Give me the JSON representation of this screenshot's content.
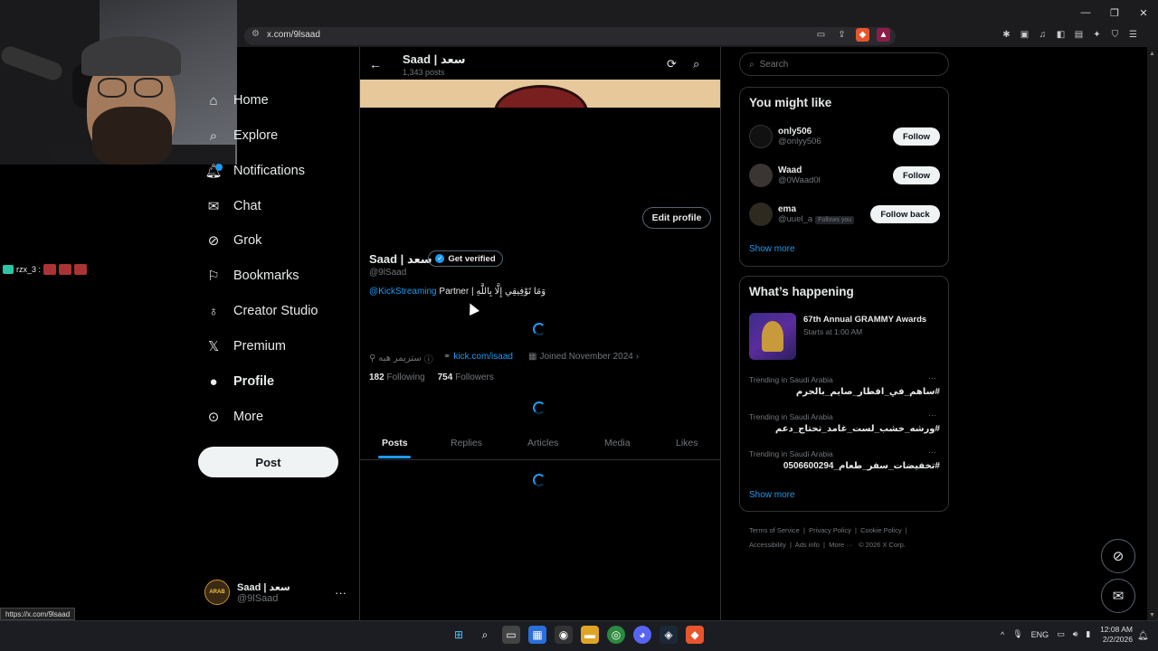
{
  "browser": {
    "url": "x.com/9lsaad",
    "status_url": "https://x.com/9lsaad"
  },
  "stream": {
    "chat_user": "rzx_3 :"
  },
  "nav": {
    "items": [
      {
        "label": "Home",
        "icon": "home-icon"
      },
      {
        "label": "Explore",
        "icon": "search-icon"
      },
      {
        "label": "Notifications",
        "icon": "bell-icon"
      },
      {
        "label": "Chat",
        "icon": "mail-icon"
      },
      {
        "label": "Grok",
        "icon": "grok-icon"
      },
      {
        "label": "Bookmarks",
        "icon": "bookmark-icon"
      },
      {
        "label": "Creator Studio",
        "icon": "creator-icon"
      },
      {
        "label": "Premium",
        "icon": "x-logo-icon"
      },
      {
        "label": "Profile",
        "icon": "person-icon"
      },
      {
        "label": "More",
        "icon": "more-circle-icon"
      }
    ],
    "post_label": "Post",
    "account": {
      "name": "Saad | سعد",
      "handle": "@9lSaad",
      "avatar_text": "ARAB"
    }
  },
  "profile": {
    "header_name": "Saad | سعد",
    "header_posts": "1,343 posts",
    "name": "Saad | سعد",
    "get_verified": "Get verified",
    "handle": "@9lSaad",
    "bio_link": "@KickStreaming",
    "bio_text": " Partner | وَمَا تَوْفِيقِي إِلَّا بِاللَّهِ",
    "edit_profile": "Edit profile",
    "location": "ستريمر هبه",
    "website": "kick.com/isaad",
    "joined": "Joined November 2024",
    "following_count": "182",
    "following_label": "Following",
    "followers_count": "754",
    "followers_label": "Followers",
    "tabs": [
      "Posts",
      "Replies",
      "Articles",
      "Media",
      "Likes"
    ]
  },
  "sidebar": {
    "search_placeholder": "Search",
    "might_like_title": "You might like",
    "suggestions": [
      {
        "name": "only506",
        "handle": "@onlyy506",
        "button": "Follow",
        "follows_you": ""
      },
      {
        "name": "Waad",
        "handle": "@0Waad0l",
        "button": "Follow",
        "follows_you": ""
      },
      {
        "name": "ema",
        "handle": "@uuel_a",
        "button": "Follow back",
        "follows_you": "Follows you"
      }
    ],
    "show_more": "Show more",
    "happening_title": "What’s happening",
    "event": {
      "title": "67th Annual GRAMMY Awards",
      "sub": "Starts at 1:00 AM"
    },
    "trends": [
      {
        "meta": "Trending in Saudi Arabia",
        "tag": "#ساهم_في_افطار_صايم_بالحرم"
      },
      {
        "meta": "Trending in Saudi Arabia",
        "tag": "#ورشه_خشب_لست_غامد_تحتاج_دعم"
      },
      {
        "meta": "Trending in Saudi Arabia",
        "tag": "#تخفيضات_سفر_طعام_0506600294"
      }
    ],
    "footer": [
      "Terms of Service",
      "Privacy Policy",
      "Cookie Policy",
      "Accessibility",
      "Ads info",
      "More ···",
      "© 2026 X Corp."
    ]
  },
  "taskbar": {
    "lang": "ENG",
    "time": "12:08 AM",
    "date": "2/2/2026"
  },
  "colors": {
    "accent": "#1d9bf0",
    "background": "#000000",
    "border": "#2f3336"
  }
}
